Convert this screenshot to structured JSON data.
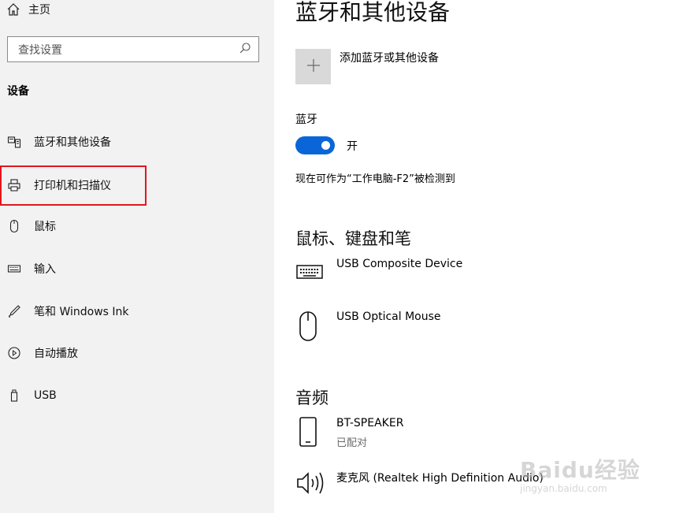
{
  "sidebar": {
    "home": "主页",
    "search_placeholder": "查找设置",
    "section_title": "设备",
    "items": [
      {
        "label": "蓝牙和其他设备",
        "icon": "bluetooth-devices-icon"
      },
      {
        "label": "打印机和扫描仪",
        "icon": "printer-icon"
      },
      {
        "label": "鼠标",
        "icon": "mouse-icon"
      },
      {
        "label": "输入",
        "icon": "keyboard-icon"
      },
      {
        "label": "笔和 Windows Ink",
        "icon": "pen-icon"
      },
      {
        "label": "自动播放",
        "icon": "autoplay-icon"
      },
      {
        "label": "USB",
        "icon": "usb-icon"
      }
    ],
    "highlighted_item": "打印机和扫描仪"
  },
  "main": {
    "title": "蓝牙和其他设备",
    "add_device_label": "添加蓝牙或其他设备",
    "bluetooth_label": "蓝牙",
    "bluetooth_state": "开",
    "discoverable_text": "现在可作为“工作电脑-F2”被检测到",
    "sections": [
      {
        "title": "鼠标、键盘和笔",
        "devices": [
          {
            "name": "USB Composite Device",
            "icon": "keyboard-icon"
          },
          {
            "name": "USB Optical Mouse",
            "icon": "mouse-icon"
          }
        ]
      },
      {
        "title": "音频",
        "devices": [
          {
            "name": "BT-SPEAKER",
            "status": "已配对",
            "icon": "speaker-device-icon"
          },
          {
            "name": "麦克风 (Realtek High Definition Audio)",
            "icon": "volume-icon"
          }
        ]
      }
    ]
  },
  "watermark": {
    "line1": "Baidu经验",
    "line2": "jingyan.baidu.com"
  },
  "colors": {
    "accent": "#0a66d8",
    "highlight_border": "#e2161c",
    "sidebar_bg": "#f2f2f2"
  }
}
